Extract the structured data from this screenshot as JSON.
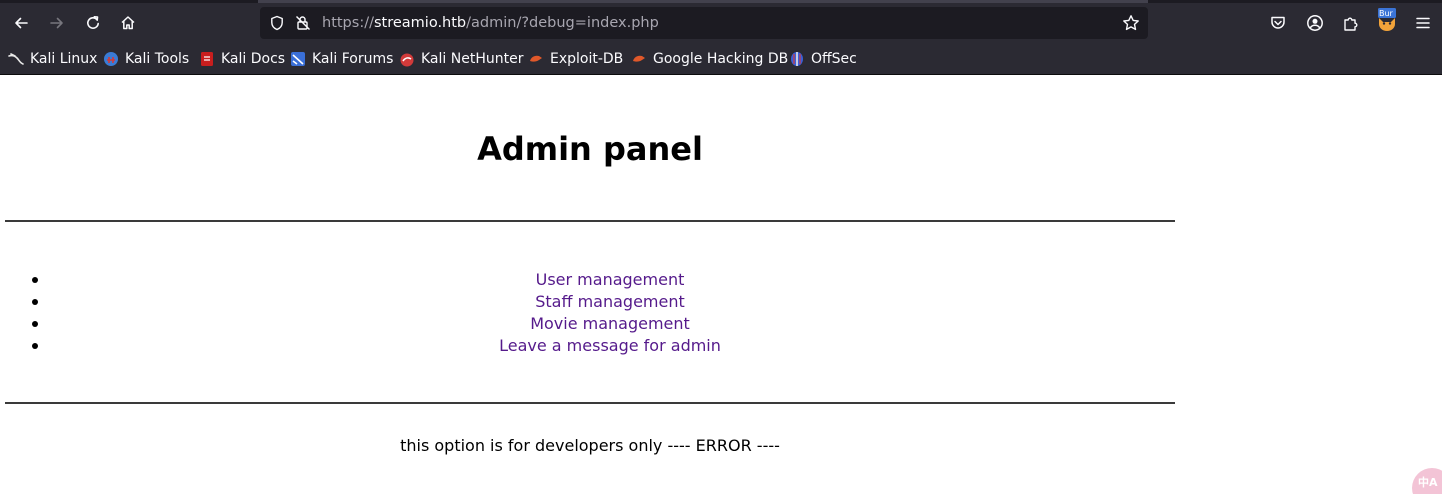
{
  "browser": {
    "url_scheme": "https://",
    "url_host": "streamio.htb",
    "url_path": "/admin/?debug=index.php",
    "extension_badge": "Bur"
  },
  "bookmarks": [
    {
      "label": "Kali Linux",
      "icon": "kali-dragon-icon",
      "color": "#e8e8e8"
    },
    {
      "label": "Kali Tools",
      "icon": "kali-tools-icon",
      "color": "#3a7bd5"
    },
    {
      "label": "Kali Docs",
      "icon": "kali-docs-icon",
      "color": "#d12a2a"
    },
    {
      "label": "Kali Forums",
      "icon": "kali-forums-icon",
      "color": "#3a6fd8"
    },
    {
      "label": "Kali NetHunter",
      "icon": "nethunter-icon",
      "color": "#d23a3a"
    },
    {
      "label": "Exploit-DB",
      "icon": "exploit-db-icon",
      "color": "#e0582a"
    },
    {
      "label": "Google Hacking DB",
      "icon": "ghdb-icon",
      "color": "#e0582a"
    },
    {
      "label": "OffSec",
      "icon": "offsec-icon",
      "color": "#3a5fd8"
    }
  ],
  "page": {
    "title": "Admin panel",
    "menu": [
      "User management",
      "Staff management",
      "Movie management",
      "Leave a message for admin"
    ],
    "message": "this option is for developers only ---- ERROR ----"
  },
  "colors": {
    "link": "#551a8b",
    "chrome_bg": "#2b2a33",
    "urlbar_bg": "#1c1b22"
  }
}
